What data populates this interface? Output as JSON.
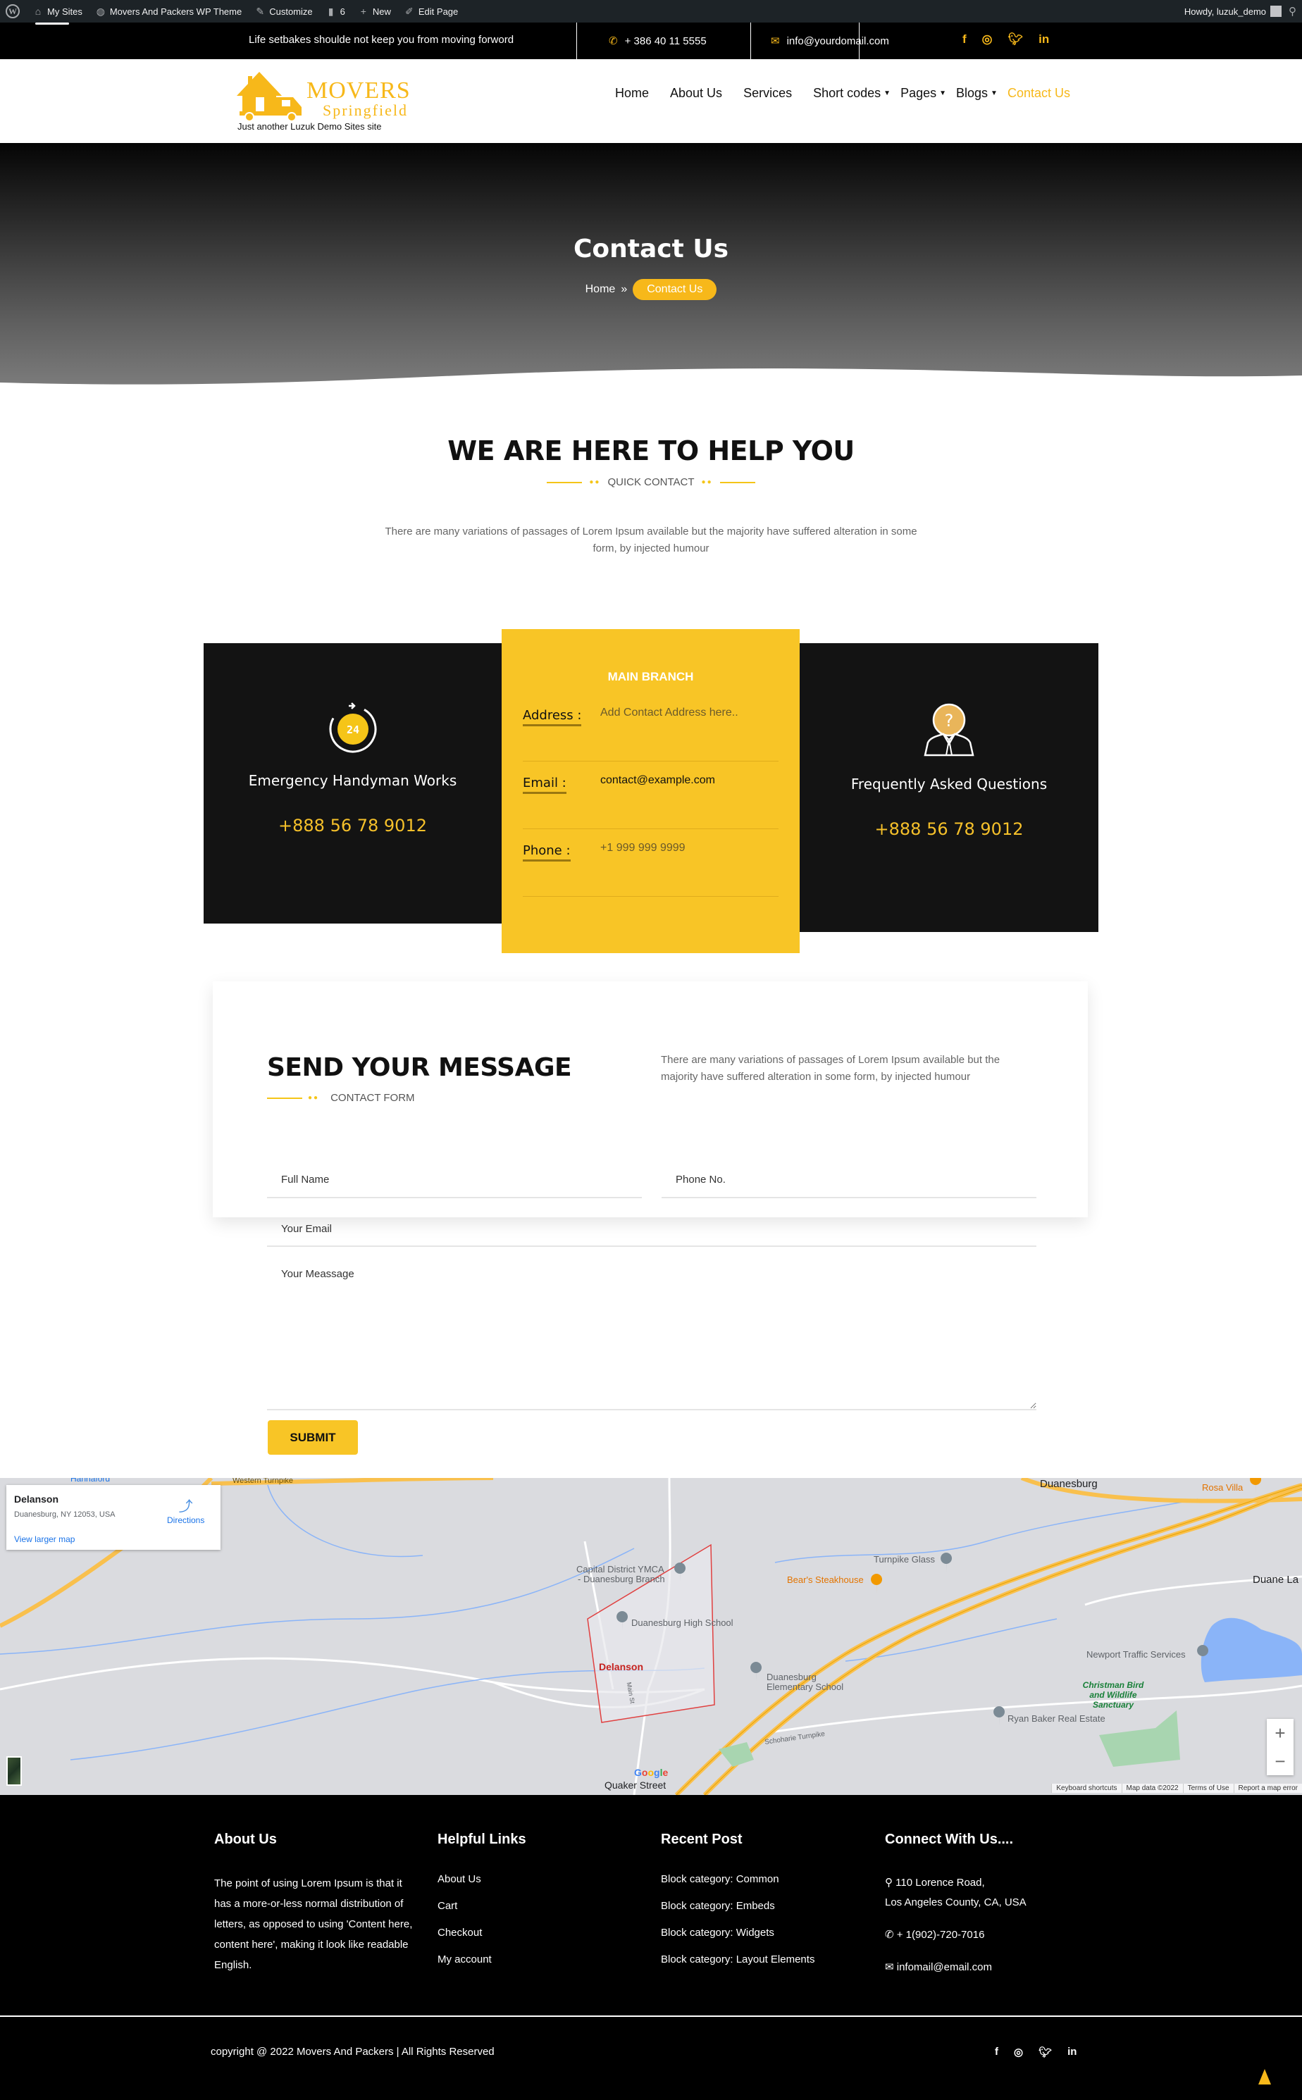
{
  "admin_bar": {
    "items": [
      {
        "icon": "wordpress-icon",
        "label": ""
      },
      {
        "icon": "my-sites-icon",
        "label": "My Sites"
      },
      {
        "icon": "site-dashboard-icon",
        "label": "Movers And Packers WP Theme"
      },
      {
        "icon": "customize-brush-icon",
        "label": "Customize"
      },
      {
        "icon": "comment-icon",
        "label": "6"
      },
      {
        "icon": "plus-icon",
        "label": "New"
      },
      {
        "icon": "pencil-icon",
        "label": "Edit Page"
      }
    ],
    "greeting": "Howdy, luzuk_demo"
  },
  "topbar": {
    "tagline": "Life setbakes shoulde not keep you from moving forword",
    "phone": "+ 386 40 11 5555",
    "email": "info@yourdomail.com",
    "socials": [
      "facebook-icon",
      "instagram-icon",
      "twitter-icon",
      "linkedin-icon"
    ]
  },
  "brand": {
    "name_top": "MOVERS",
    "name_bottom": "Springfield",
    "tagline": "Just another Luzuk Demo Sites site",
    "accent_color": "#f7b81a"
  },
  "nav": [
    {
      "label": "Home",
      "dropdown": false,
      "active": false
    },
    {
      "label": "About Us",
      "dropdown": false,
      "active": false
    },
    {
      "label": "Services",
      "dropdown": false,
      "active": false
    },
    {
      "label": "Short codes",
      "dropdown": true,
      "active": false
    },
    {
      "label": "Pages",
      "dropdown": true,
      "active": false
    },
    {
      "label": "Blogs",
      "dropdown": true,
      "active": false
    },
    {
      "label": "Contact Us",
      "dropdown": false,
      "active": true
    }
  ],
  "hero": {
    "title": "Contact Us",
    "breadcrumb_home": "Home",
    "breadcrumb_sep": "»",
    "breadcrumb_current": "Contact Us"
  },
  "help": {
    "title": "WE ARE HERE TO HELP YOU",
    "subtitle": "QUICK CONTACT",
    "text": "There are many variations of passages of Lorem Ipsum available but the majority have suffered alteration in some form, by injected humour"
  },
  "cards": {
    "emergency": {
      "title": "Emergency Handyman Works",
      "phone": "+888 56 78 9012",
      "icon_text": "24"
    },
    "branch": {
      "title": "MAIN BRANCH",
      "rows": [
        {
          "label": "Address :",
          "value": "Add Contact Address here.."
        },
        {
          "label": "Email :",
          "value": "contact@example.com"
        },
        {
          "label": "Phone :",
          "value": "+1 999 999 9999"
        }
      ]
    },
    "faq": {
      "title": "Frequently Asked Questions",
      "phone": "+888 56 78 9012"
    }
  },
  "message": {
    "title": "SEND YOUR MESSAGE",
    "subtitle": "CONTACT FORM",
    "text": "There are many variations of passages of Lorem Ipsum available but the majority have suffered alteration in some form, by injected humour",
    "fields": {
      "name_placeholder": "Full Name",
      "phone_placeholder": "Phone No.",
      "email_placeholder": "Your Email",
      "message_placeholder": "Your Meassage"
    },
    "submit": "SUBMIT"
  },
  "map": {
    "place": "Delanson",
    "address": "Duanesburg, NY 12053, USA",
    "directions": "Directions",
    "view_larger": "View larger map",
    "labels": {
      "duanesburg": "Duanesburg",
      "rosa_villa": "Rosa Villa",
      "duane_lake": "Duane La",
      "ymca_1": "Capital District YMCA",
      "ymca_2": "- Duanesburg Branch",
      "high_school": "Duanesburg High School",
      "delanson": "Delanson",
      "elementary_1": "Duanesburg",
      "elementary_2": "Elementary School",
      "turnpike_glass": "Turnpike Glass",
      "bears": "Bear's Steakhouse",
      "newport": "Newport Traffic Services",
      "christman": "Christman Bird and Wildlife Sanctuary",
      "ryan": "Ryan Baker Real Estate",
      "quaker": "Quaker Street",
      "western_turnpike": "Western Turnpike",
      "schoharie": "Schoharie Turnpike",
      "hannaford": "Hannaford",
      "main_st": "Main St"
    },
    "footer": [
      "Keyboard shortcuts",
      "Map data ©2022",
      "Terms of Use",
      "Report a map error"
    ],
    "zoom_in": "+",
    "zoom_out": "−"
  },
  "footer": {
    "about": {
      "title": "About Us",
      "text": "The point of using Lorem Ipsum is that it has a more-or-less normal distribution of letters, as opposed to using 'Content here, content here', making it look like readable English."
    },
    "links": {
      "title": "Helpful Links",
      "items": [
        "About Us",
        "Cart",
        "Checkout",
        "My account"
      ]
    },
    "recent": {
      "title": "Recent Post",
      "items": [
        "Block category: Common",
        "Block category: Embeds",
        "Block category: Widgets",
        "Block category: Layout Elements"
      ]
    },
    "connect": {
      "title": "Connect With Us....",
      "address_1": "110 Lorence Road,",
      "address_2": "Los Angeles County, CA, USA",
      "phone": "+ 1(902)-720-7016",
      "email": "infomail@email.com"
    },
    "copyright": "copyright @ 2022 Movers And Packers | All Rights Reserved"
  }
}
